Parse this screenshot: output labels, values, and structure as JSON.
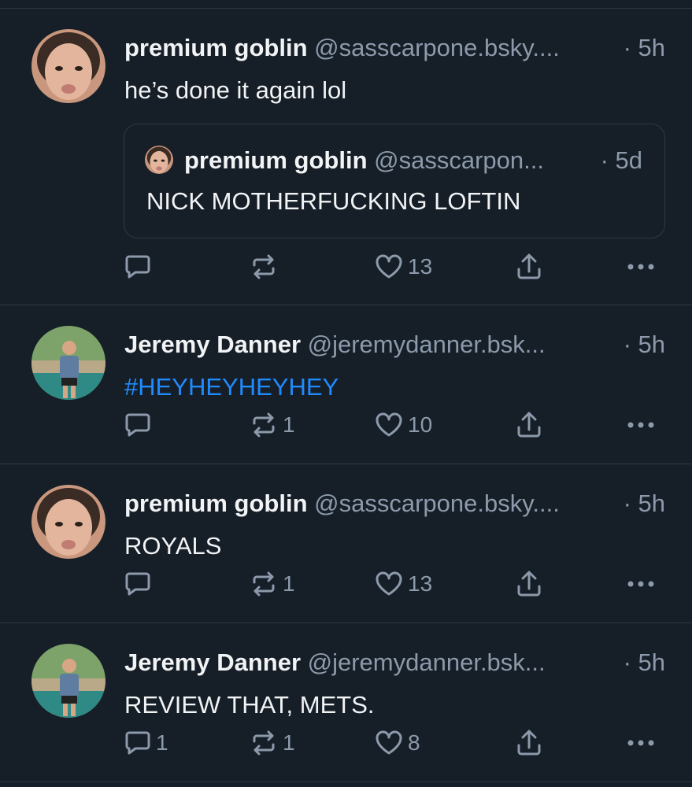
{
  "colors": {
    "background": "#161e27",
    "divider": "#2e3a48",
    "text": "#f1f3f5",
    "muted": "#8c9aab",
    "link": "#208bfe"
  },
  "posts": [
    {
      "name": "premium goblin",
      "handle": "@sasscarpone.bsky....",
      "time": "· 5h",
      "text": "he’s done it again lol",
      "quote": {
        "name": "premium goblin",
        "handle": "@sasscarpon...",
        "time": "· 5d",
        "text": "NICK MOTHERFUCKING LOFTIN"
      },
      "counts": {
        "reply": "",
        "repost": "",
        "like": "13"
      }
    },
    {
      "name": "Jeremy Danner",
      "handle": "@jeremydanner.bsk...",
      "time": "· 5h",
      "text": "#HEYHEYHEYHEY",
      "counts": {
        "reply": "",
        "repost": "1",
        "like": "10"
      }
    },
    {
      "name": "premium goblin",
      "handle": "@sasscarpone.bsky....",
      "time": "· 5h",
      "text": "ROYALS",
      "counts": {
        "reply": "",
        "repost": "1",
        "like": "13"
      }
    },
    {
      "name": "Jeremy Danner",
      "handle": "@jeremydanner.bsk...",
      "time": "· 5h",
      "text": "REVIEW THAT, METS.",
      "counts": {
        "reply": "1",
        "repost": "1",
        "like": "8"
      }
    }
  ]
}
